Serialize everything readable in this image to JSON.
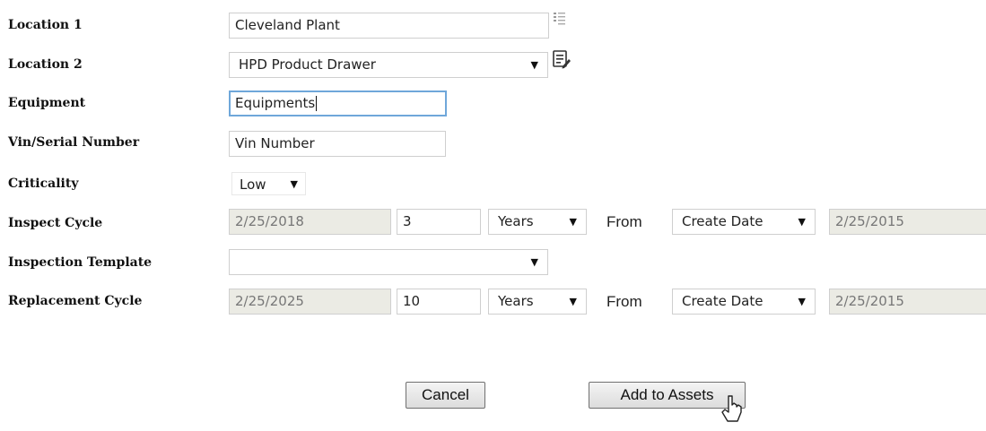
{
  "form": {
    "location1": {
      "label": "Location 1",
      "value": "Cleveland Plant"
    },
    "location2": {
      "label": "Location 2",
      "value": "HPD Product Drawer"
    },
    "equipment": {
      "label": "Equipment",
      "value": "Equipments"
    },
    "vin": {
      "label": "Vin/Serial Number",
      "value": "Vin Number"
    },
    "criticality": {
      "label": "Criticality",
      "value": "Low"
    },
    "inspect_cycle": {
      "label": "Inspect Cycle",
      "due_date": "2/25/2018",
      "count": "3",
      "unit": "Years",
      "from_label": "From",
      "from_basis": "Create Date",
      "from_date": "2/25/2015"
    },
    "inspection_template": {
      "label": "Inspection Template",
      "value": ""
    },
    "replacement_cycle": {
      "label": "Replacement Cycle",
      "due_date": "2/25/2025",
      "count": "10",
      "unit": "Years",
      "from_label": "From",
      "from_basis": "Create Date",
      "from_date": "2/25/2015"
    }
  },
  "actions": {
    "cancel": "Cancel",
    "add": "Add to Assets"
  },
  "icons": {
    "location1_picker": "list-icon",
    "location2_editor": "edit-list-icon",
    "dropdown": "triangle-down",
    "cursor": "mouse-pointer"
  }
}
